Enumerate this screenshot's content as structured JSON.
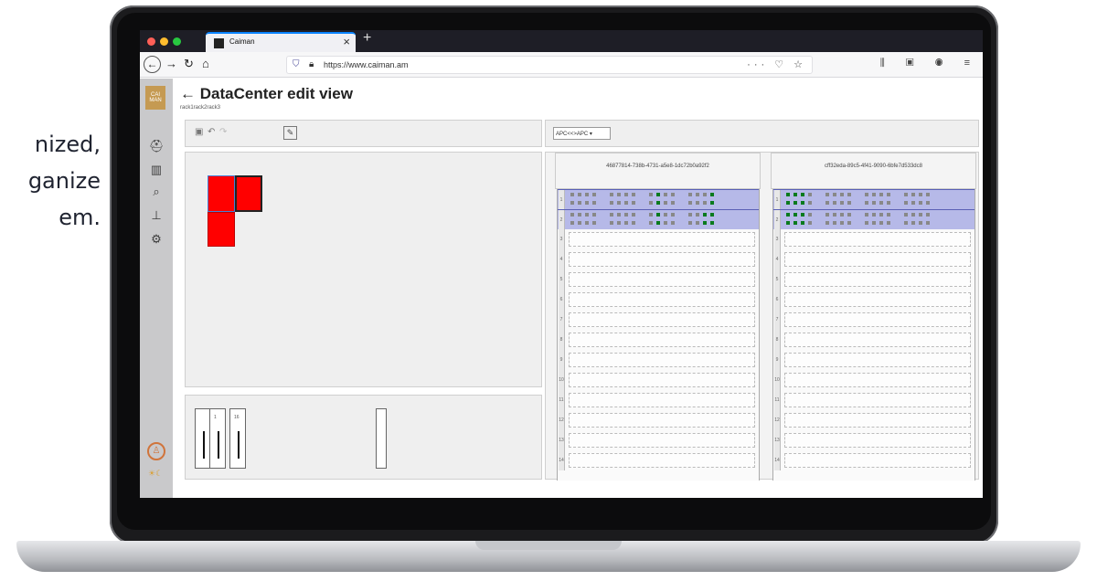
{
  "background_text": {
    "lines": [
      "nized,",
      "ganize",
      "em."
    ]
  },
  "browser": {
    "tab_title": "Caiman",
    "url": "https://www.caiman.am",
    "traffic_colors": [
      "#ff5f57",
      "#febc2e",
      "#28c840"
    ]
  },
  "app": {
    "logo": "CAI MAN",
    "page_title": "DataCenter edit view",
    "breadcrumb": "rack1rack2rack3",
    "pdu_select": "APC<<>APC",
    "pdu_numbers": [
      "1",
      "16"
    ],
    "racks": [
      {
        "id": "46877814-738b-4731-a5e8-1dc72b0a92f2"
      },
      {
        "id": "cff32eda-89c5-4f41-9090-6bfe7d533dc8"
      }
    ],
    "unit_numbers": [
      "1",
      "2",
      "3",
      "4",
      "5",
      "6",
      "7",
      "8",
      "9",
      "10",
      "11",
      "12",
      "13",
      "14"
    ],
    "accent_red": "#ff0000",
    "device_highlight": "#b6b9e8"
  }
}
